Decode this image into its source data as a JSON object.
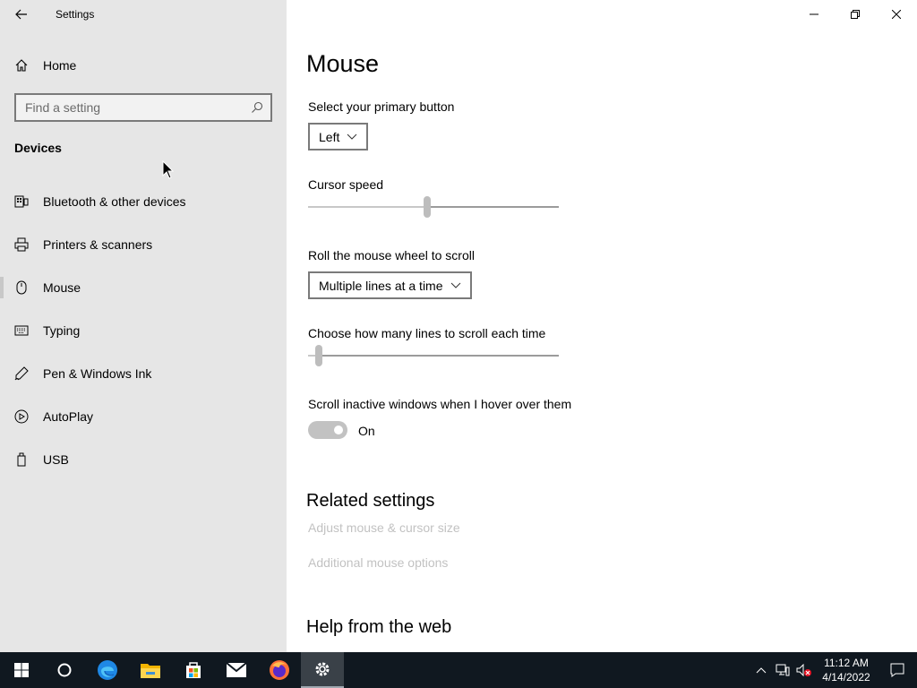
{
  "window": {
    "title": "Settings"
  },
  "sidebar": {
    "home_label": "Home",
    "search_placeholder": "Find a setting",
    "section": "Devices",
    "items": [
      {
        "label": "Bluetooth & other devices",
        "icon": "keyboard-icon"
      },
      {
        "label": "Printers & scanners",
        "icon": "printer-icon"
      },
      {
        "label": "Mouse",
        "icon": "mouse-icon",
        "selected": true
      },
      {
        "label": "Typing",
        "icon": "keyboard-icon"
      },
      {
        "label": "Pen & Windows Ink",
        "icon": "pen-icon"
      },
      {
        "label": "AutoPlay",
        "icon": "autoplay-icon"
      },
      {
        "label": "USB",
        "icon": "usb-icon"
      }
    ]
  },
  "main": {
    "title": "Mouse",
    "primary_button_label": "Select your primary button",
    "primary_button_value": "Left",
    "cursor_speed_label": "Cursor speed",
    "cursor_speed_fraction": 0.475,
    "wheel_label": "Roll the mouse wheel to scroll",
    "wheel_value": "Multiple lines at a time",
    "lines_label": "Choose how many lines to scroll each time",
    "lines_fraction": 0.03,
    "inactive_label": "Scroll inactive windows when I hover over them",
    "inactive_state": "On",
    "related_title": "Related settings",
    "related_links": [
      "Adjust mouse & cursor size",
      "Additional mouse options"
    ],
    "help_title": "Help from the web"
  },
  "taskbar": {
    "time": "11:12 AM",
    "date": "4/14/2022"
  },
  "colors": {
    "sidebar_bg": "#e6e6e6",
    "taskbar_bg": "#101820",
    "link_disabled": "#c2c2c2"
  }
}
